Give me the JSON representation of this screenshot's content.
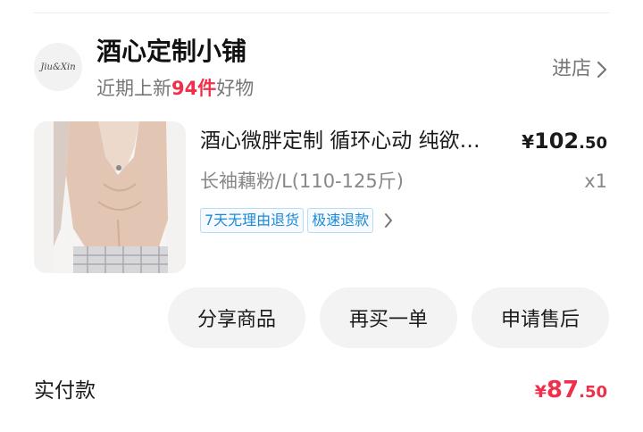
{
  "store": {
    "logo_text": "Jiu&Xin",
    "name": "酒心定制小铺",
    "subtitle_prefix": "近期上新",
    "new_count": "94件",
    "subtitle_suffix": "好物",
    "enter_label": "进店"
  },
  "product": {
    "title": "酒心微胖定制 循环心动 纯欲风露肩针织上衣",
    "price_currency": "¥",
    "price_int": "102",
    "price_dec": ".50",
    "spec": "长袖藕粉/L(110-125斤)",
    "qty": "x1",
    "tags": [
      "7天无理由退货",
      "极速退款"
    ]
  },
  "actions": {
    "share": "分享商品",
    "rebuy": "再买一单",
    "after_sale": "申请售后"
  },
  "payment": {
    "label": "实付款",
    "currency": "¥",
    "amount_int": "87",
    "amount_dec": ".50"
  },
  "colors": {
    "accent": "#f0304a",
    "tag_blue": "#1b8ad6",
    "button_bg": "#f3f3f3"
  },
  "icons": {
    "enter_store": "chevron-right-icon",
    "tags_more": "chevron-right-icon"
  }
}
